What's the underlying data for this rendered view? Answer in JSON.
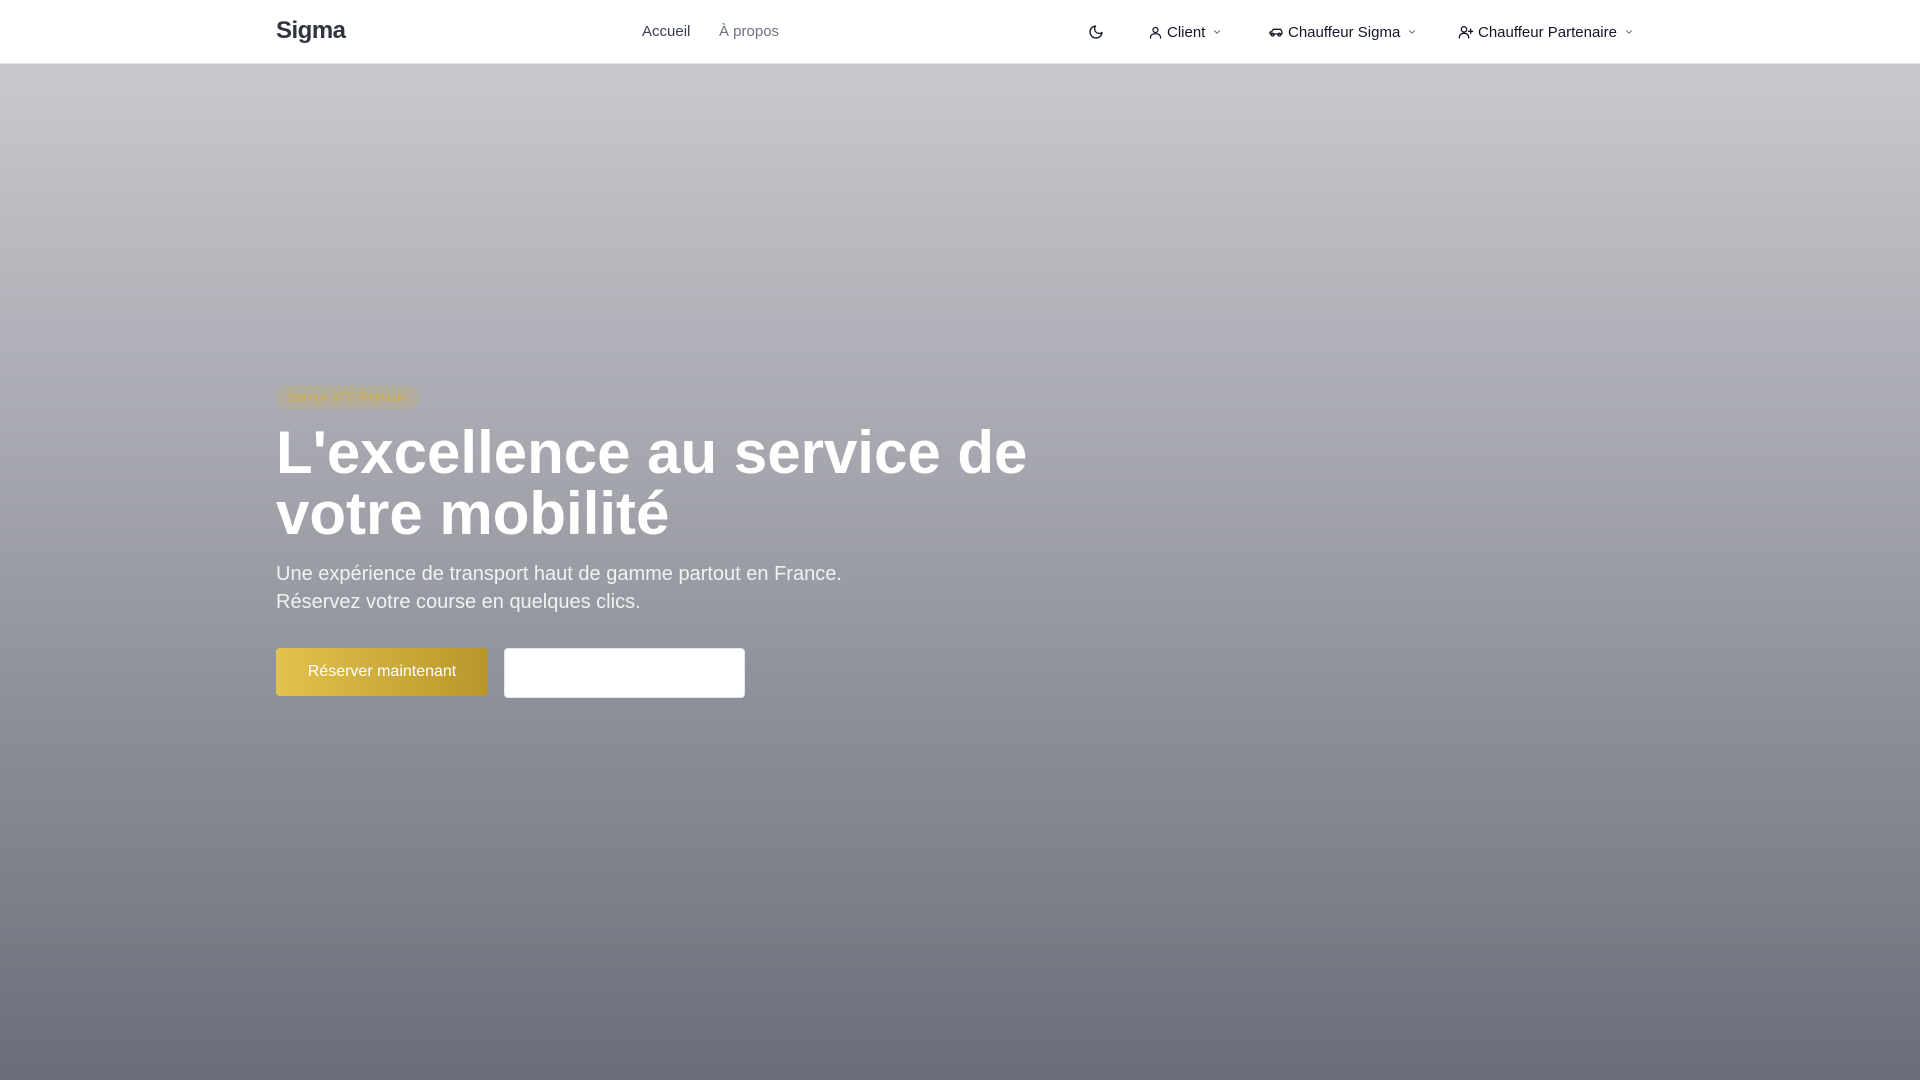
{
  "header": {
    "logo": "Sigma",
    "nav": [
      {
        "label": "Accueil"
      },
      {
        "label": "À propos"
      }
    ],
    "theme_toggle_icon": "moon-icon",
    "menus": [
      {
        "label": "Client",
        "icon": "user-icon"
      },
      {
        "label": "Chauffeur Sigma",
        "icon": "car-icon"
      },
      {
        "label": "Chauffeur Partenaire",
        "icon": "user-plus-icon"
      }
    ]
  },
  "hero": {
    "badge": "Service VTC Premium",
    "title": "L'excellence au service de votre mobilité",
    "subtitle_line1": "Une expérience de transport haut de gamme partout en France.",
    "subtitle_line2": "Réservez votre course en quelques clics.",
    "primary_button": "Réserver maintenant",
    "secondary_button": ""
  },
  "colors": {
    "accent_gold": "#d4b24a",
    "header_bg": "#ffffff",
    "hero_gradient_top": "#c8c9cd",
    "hero_gradient_bottom": "#6b6d79"
  }
}
